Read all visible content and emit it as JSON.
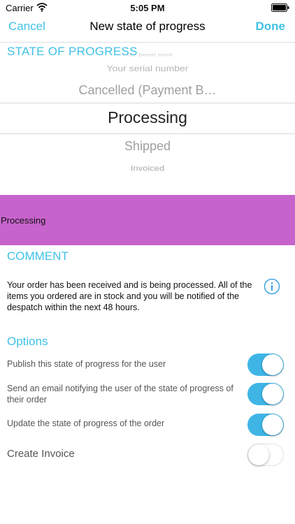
{
  "status_bar": {
    "carrier": "Carrier",
    "time": "5:05 PM"
  },
  "nav": {
    "cancel": "Cancel",
    "title": "New state of progress",
    "done": "Done"
  },
  "picker": {
    "header": "STATE OF PROGRESS",
    "rows": [
      "Has been sent",
      "Your serial number",
      "Cancelled (Payment B…",
      "Processing",
      "Shipped",
      "Invoiced"
    ],
    "selected_index": 3
  },
  "band": {
    "label": "Processing",
    "color": "#c763cc"
  },
  "comment": {
    "header": "COMMENT",
    "text": "Your order has been received and is being processed. All of the items you ordered are in stock and you will be notified of the despatch within the next 48 hours."
  },
  "options": {
    "header": "Options",
    "items": [
      {
        "label": "Publish this state of progress for the user",
        "on": true
      },
      {
        "label": "Send an email notifying the user of the state of progress of their order",
        "on": true
      },
      {
        "label": "Update the state of progress of the order",
        "on": true
      },
      {
        "label": "Create Invoice",
        "on": false
      }
    ]
  },
  "colors": {
    "accent": "#3fc1e6",
    "toggle_on": "#3fb5e6",
    "band": "#c763cc"
  },
  "icons": {
    "info": "info-icon",
    "wifi": "wifi-icon",
    "battery": "battery-icon"
  }
}
